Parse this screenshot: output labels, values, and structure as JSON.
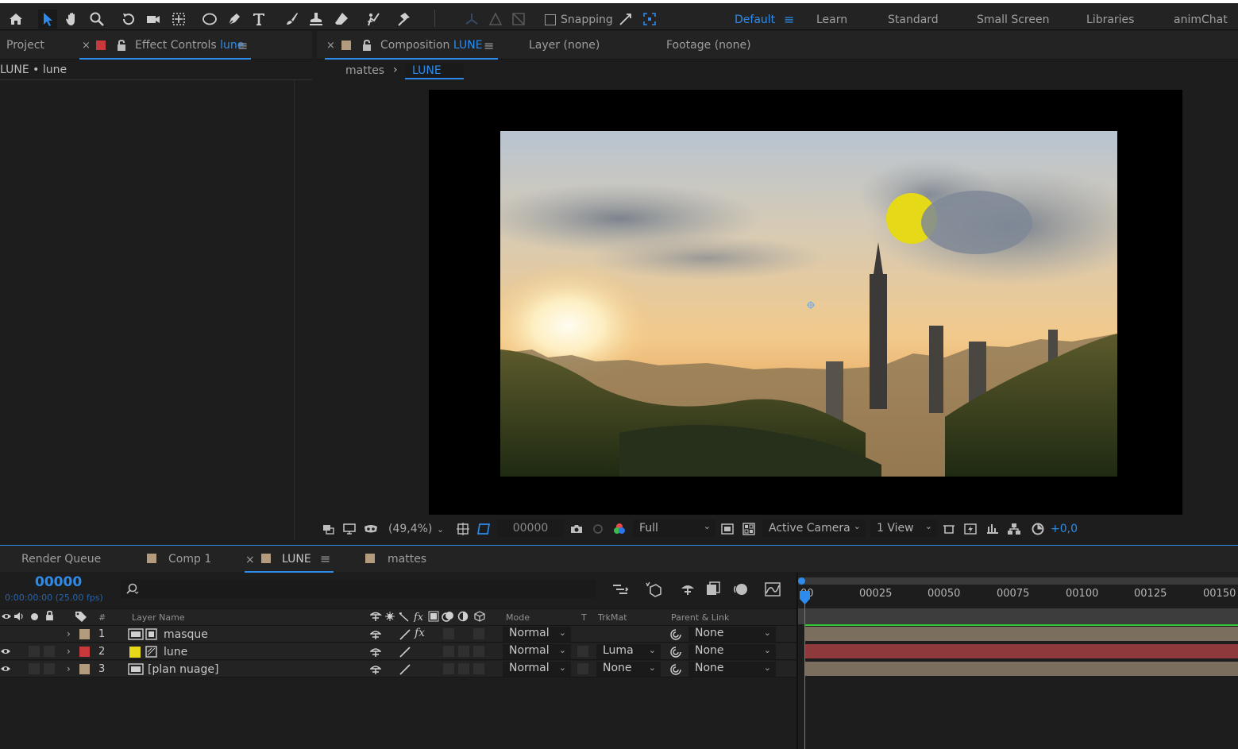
{
  "toolbar": {
    "tools": [
      "home-icon",
      "selection-tool-icon",
      "hand-tool-icon",
      "zoom-tool-icon",
      "rotate-tool-icon",
      "camera-tool-icon",
      "pan-behind-tool-icon",
      "ellipse-tool-icon",
      "pen-tool-icon",
      "type-tool-icon",
      "brush-tool-icon",
      "clone-stamp-tool-icon",
      "eraser-tool-icon",
      "roto-brush-tool-icon",
      "puppet-tool-icon"
    ],
    "snapping_label": "Snapping",
    "workspaces": [
      "Default",
      "Learn",
      "Standard",
      "Small Screen",
      "Libraries",
      "animChat"
    ],
    "active_workspace": "Default"
  },
  "effect_panel": {
    "project_tab": "Project",
    "effect_tab_prefix": "Effect Controls",
    "effect_tab_layer": "lune",
    "breadcrumb": "LUNE • lune"
  },
  "viewer": {
    "comp_tab_prefix": "Composition",
    "comp_tab_name": "LUNE",
    "layer_tab": "Layer  (none)",
    "footage_tab": "Footage  (none)",
    "crumb_parent": "mattes",
    "crumb_current": "LUNE",
    "footer": {
      "zoom": "(49,4%)",
      "timecode": "00000",
      "resolution": "Full",
      "camera": "Active Camera",
      "views": "1 View",
      "exposure": "+0,0"
    }
  },
  "timeline": {
    "tabs": [
      "Render Queue",
      "Comp 1",
      "LUNE",
      "mattes"
    ],
    "active_tab": "LUNE",
    "timecode": "00000",
    "timecode_sub": "0:00:00:00 (25.00 fps)",
    "columns": {
      "hash": "#",
      "layer_name": "Layer Name",
      "mode": "Mode",
      "t": "T",
      "trkmat": "TrkMat",
      "parent": "Parent & Link"
    },
    "ruler": [
      "00",
      "00025",
      "00050",
      "00075",
      "00100",
      "00125",
      "00150"
    ],
    "layers": [
      {
        "num": "1",
        "name": "masque",
        "label_color": "#b39b7e",
        "mode": "Normal",
        "trkmat": "",
        "parent": "None",
        "bar_color": "#7c6e5e"
      },
      {
        "num": "2",
        "name": "lune",
        "label_color": "#c9393b",
        "mode": "Normal",
        "trkmat": "Luma",
        "parent": "None",
        "bar_color": "#8e3a3c"
      },
      {
        "num": "3",
        "name": "[plan nuage]",
        "label_color": "#b39b7e",
        "mode": "Normal",
        "trkmat": "None",
        "parent": "None",
        "bar_color": "#7c6e5e"
      }
    ]
  },
  "colors": {
    "accent": "#2d8ceb",
    "panel": "#1d1d1d",
    "header": "#232323",
    "moon": "#e6d917"
  }
}
